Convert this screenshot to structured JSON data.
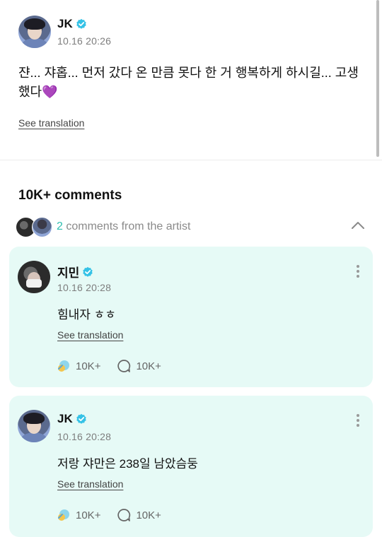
{
  "post": {
    "author": "JK",
    "date": "10.16 20:26",
    "text": "쟌... 쟈홉... 먼저 갔다 온 만큼 못다 한 거 행복하게 하시길... 고생",
    "text_line2": "했다",
    "emoji": "💜",
    "see_translation": "See translation"
  },
  "comments_header": {
    "title": "10K+ comments",
    "artist_count": "2",
    "artist_label": " comments from the artist"
  },
  "comments": [
    {
      "author": "지민",
      "date": "10.16 20:28",
      "text": "힘내자 ㅎㅎ",
      "see_translation": "See translation",
      "likes": "10K+",
      "replies": "10K+"
    },
    {
      "author": "JK",
      "date": "10.16 20:28",
      "text": "저랑 쟈만은 238일 남았슴둥",
      "see_translation": "See translation",
      "likes": "10K+",
      "replies": "10K+"
    }
  ],
  "colors": {
    "accent": "#2ebfb0",
    "card_bg": "#e6faf6",
    "verified": "#35c2e6"
  },
  "icons": [
    "verified-badge-icon",
    "chevron-up-icon",
    "more-vertical-icon",
    "like-icon",
    "comment-bubble-icon"
  ]
}
